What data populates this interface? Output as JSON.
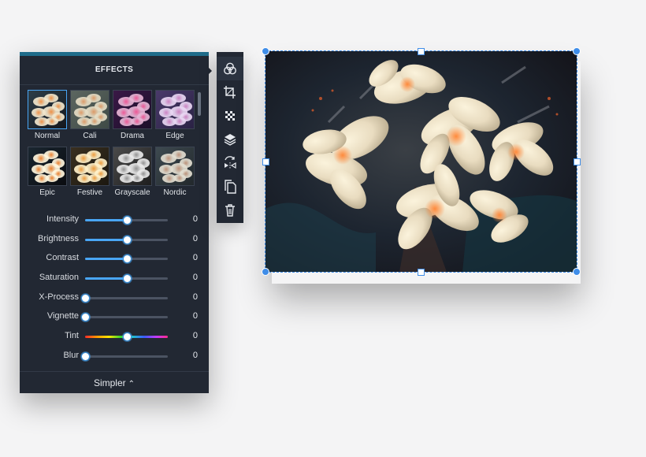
{
  "effects_panel": {
    "title": "EFFECTS",
    "filters": [
      {
        "label": "Normal",
        "selected": true
      },
      {
        "label": "Cali",
        "selected": false
      },
      {
        "label": "Drama",
        "selected": false
      },
      {
        "label": "Edge",
        "selected": false
      },
      {
        "label": "Epic",
        "selected": false
      },
      {
        "label": "Festive",
        "selected": false
      },
      {
        "label": "Grayscale",
        "selected": false
      },
      {
        "label": "Nordic",
        "selected": false
      }
    ],
    "adjustments": [
      {
        "label": "Intensity",
        "value": "0",
        "level": 0.5
      },
      {
        "label": "Brightness",
        "value": "0",
        "level": 0.5
      },
      {
        "label": "Contrast",
        "value": "0",
        "level": 0.5
      },
      {
        "label": "Saturation",
        "value": "0",
        "level": 0.5
      },
      {
        "label": "X-Process",
        "value": "0",
        "level": 0
      },
      {
        "label": "Vignette",
        "value": "0",
        "level": 0
      },
      {
        "label": "Tint",
        "value": "0",
        "level": 0.5
      },
      {
        "label": "Blur",
        "value": "0",
        "level": 0
      }
    ],
    "simpler_label": "Simpler",
    "simpler_caret": "⌃"
  },
  "toolbar": {
    "tools": [
      {
        "icon": "effects-icon",
        "active": true
      },
      {
        "icon": "crop-icon",
        "active": false
      },
      {
        "icon": "transparency-icon",
        "active": false
      },
      {
        "icon": "layers-icon",
        "active": false
      },
      {
        "icon": "flip-icon",
        "active": false
      },
      {
        "icon": "duplicate-icon",
        "active": false
      },
      {
        "icon": "trash-icon",
        "active": false
      }
    ]
  },
  "colors": {
    "panel_bg": "#222833",
    "accent": "#49a6f5",
    "selection": "#3f8de8",
    "page_bg": "#f4f4f5"
  },
  "thumb_styles": {
    "Normal": "natural",
    "Cali": "faded-warm",
    "Drama": "purple-magenta",
    "Edge": "violet",
    "Epic": "high-contrast",
    "Festive": "warm-bright",
    "Grayscale": "monochrome",
    "Nordic": "cool-muted"
  }
}
